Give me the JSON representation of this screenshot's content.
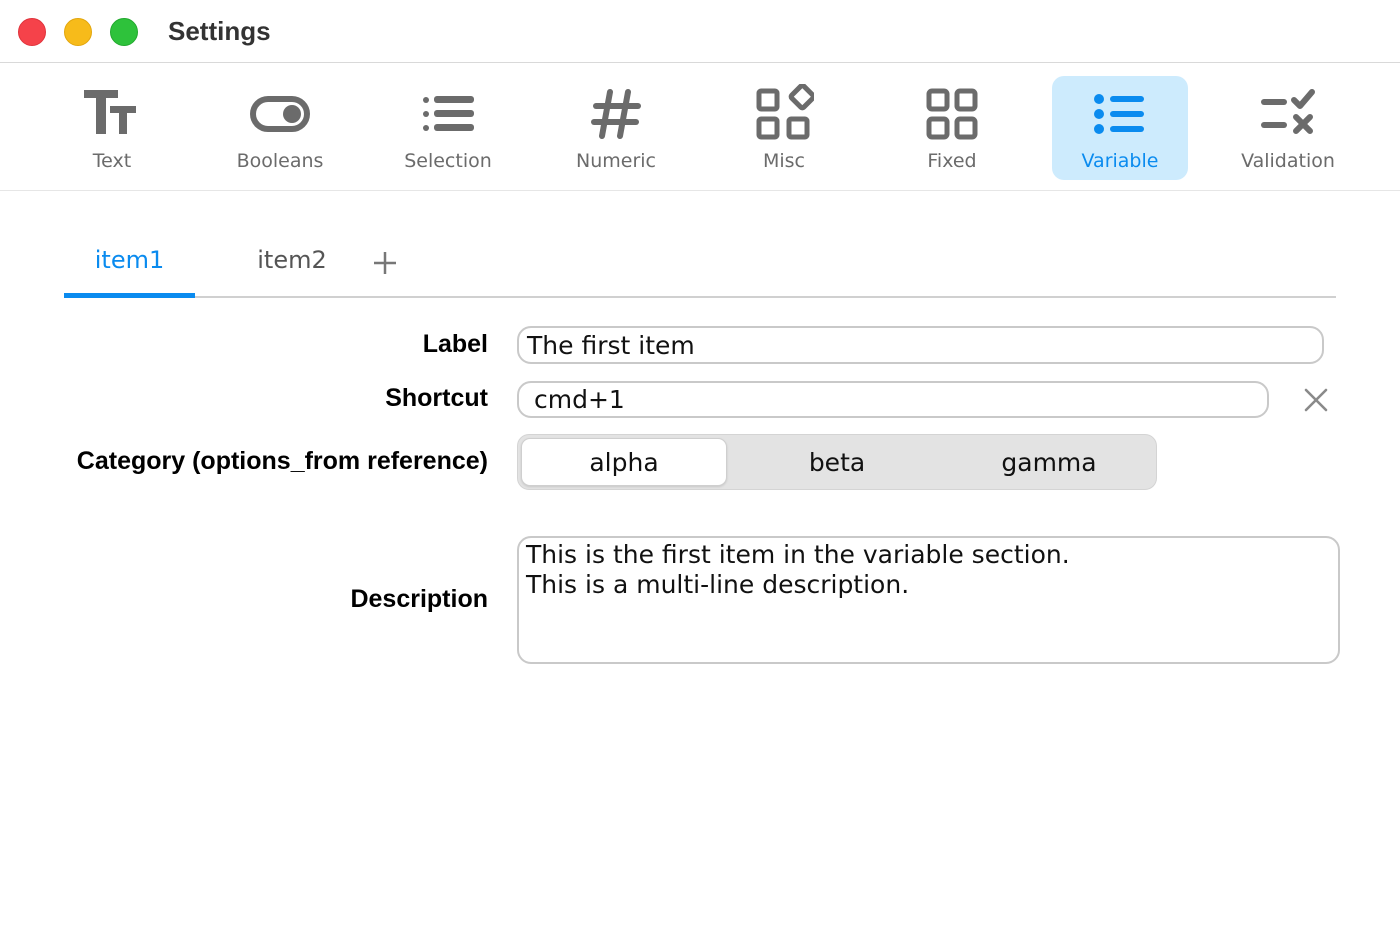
{
  "window": {
    "title": "Settings"
  },
  "toolbar": {
    "items": [
      {
        "label": "Text",
        "icon": "text-icon"
      },
      {
        "label": "Booleans",
        "icon": "toggle-icon"
      },
      {
        "label": "Selection",
        "icon": "list-icon"
      },
      {
        "label": "Numeric",
        "icon": "hash-icon"
      },
      {
        "label": "Misc",
        "icon": "shapes-icon"
      },
      {
        "label": "Fixed",
        "icon": "grid-icon"
      },
      {
        "label": "Variable",
        "icon": "bullet-list-icon"
      },
      {
        "label": "Validation",
        "icon": "validation-icon"
      }
    ],
    "active": "Variable"
  },
  "tabs": {
    "items": [
      {
        "label": "item1"
      },
      {
        "label": "item2"
      }
    ],
    "active": "item1",
    "add_icon": "plus-icon"
  },
  "form": {
    "label": {
      "caption": "Label",
      "value": "The first item"
    },
    "shortcut": {
      "caption": "Shortcut",
      "value": "cmd+1",
      "clear_icon": "close-icon"
    },
    "category": {
      "caption": "Category (options_from reference)",
      "options": [
        "alpha",
        "beta",
        "gamma"
      ],
      "selected": "alpha"
    },
    "description": {
      "caption": "Description",
      "lines": [
        "This is the first item in the variable section.",
        "This is a multi-line description."
      ]
    }
  },
  "colors": {
    "accent": "#0a8bef",
    "active_tool_bg": "#cdebfd",
    "close": "#f5424a",
    "minimize": "#f7bb1a",
    "zoom": "#2ec23b"
  }
}
